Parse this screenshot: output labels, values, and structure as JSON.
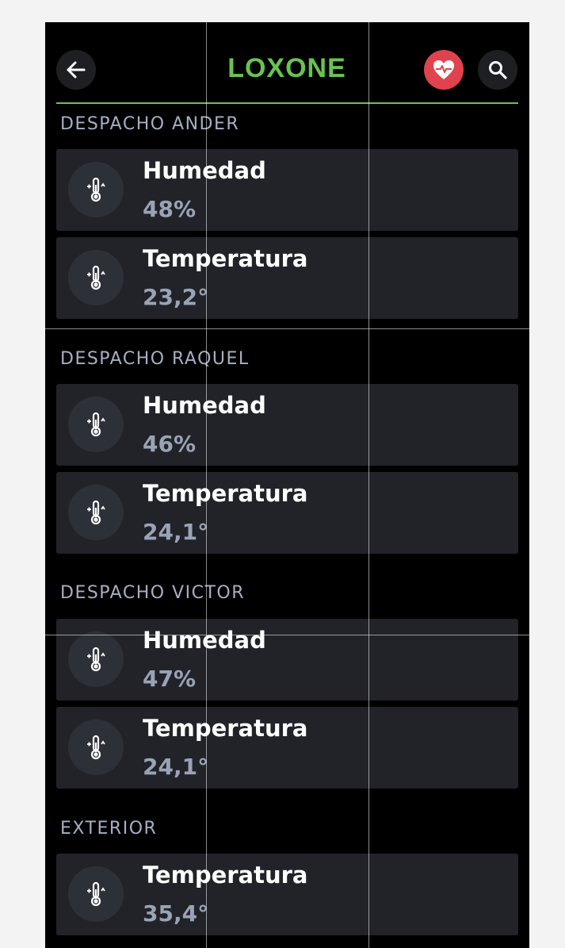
{
  "header": {
    "logo": "LOXONE",
    "back_icon": "arrow-left-icon",
    "heart_icon": "heart-pulse-icon",
    "search_icon": "search-icon",
    "accent_color": "#69c350",
    "heart_color": "#e0434e"
  },
  "sections": [
    {
      "title": "DESPACHO ANDER",
      "cards": [
        {
          "label": "Humedad",
          "value": "48%"
        },
        {
          "label": "Temperatura",
          "value": "23,2°"
        }
      ]
    },
    {
      "title": "DESPACHO RAQUEL",
      "cards": [
        {
          "label": "Humedad",
          "value": "46%"
        },
        {
          "label": "Temperatura",
          "value": "24,1°"
        }
      ]
    },
    {
      "title": "DESPACHO VICTOR",
      "cards": [
        {
          "label": "Humedad",
          "value": "47%"
        },
        {
          "label": "Temperatura",
          "value": "24,1°"
        }
      ]
    },
    {
      "title": "EXTERIOR",
      "cards": [
        {
          "label": "Temperatura",
          "value": "35,4°"
        }
      ]
    }
  ],
  "card_icon": "thermometer-icon"
}
